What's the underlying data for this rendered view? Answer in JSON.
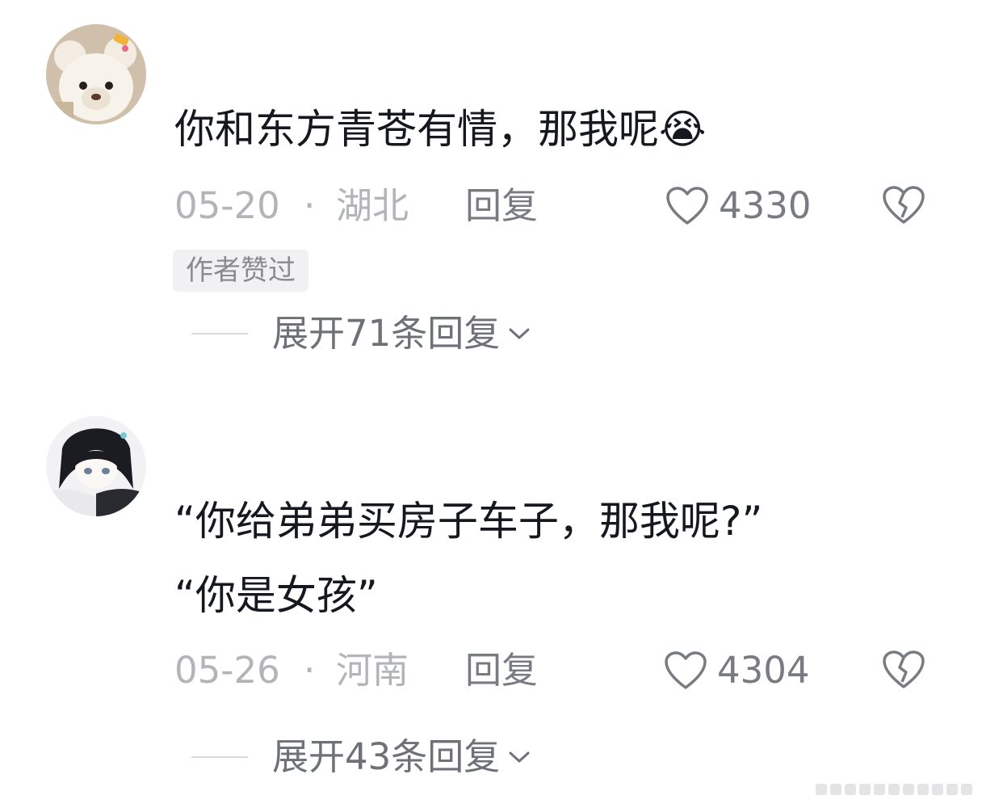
{
  "comments": [
    {
      "avatar_icon": "teddy-bear-avatar",
      "text": "你和东方青苍有情，那我呢😭",
      "date": "05-20",
      "separator": "·",
      "region": "湖北",
      "reply_label": "回复",
      "like_count": "4330",
      "badge": "作者赞过",
      "expand_label": "展开71条回复"
    },
    {
      "avatar_icon": "anime-character-avatar",
      "text_line1": "“你给弟弟买房子车子，那我呢?”",
      "text_line2": "“你是女孩”",
      "date": "05-26",
      "separator": "·",
      "region": "河南",
      "reply_label": "回复",
      "like_count": "4304",
      "expand_label": "展开43条回复"
    }
  ],
  "colors": {
    "text_primary": "#16181f",
    "meta_light": "#b3b4b9",
    "meta_dark": "#797b82",
    "badge_bg": "#f1f1f3"
  }
}
